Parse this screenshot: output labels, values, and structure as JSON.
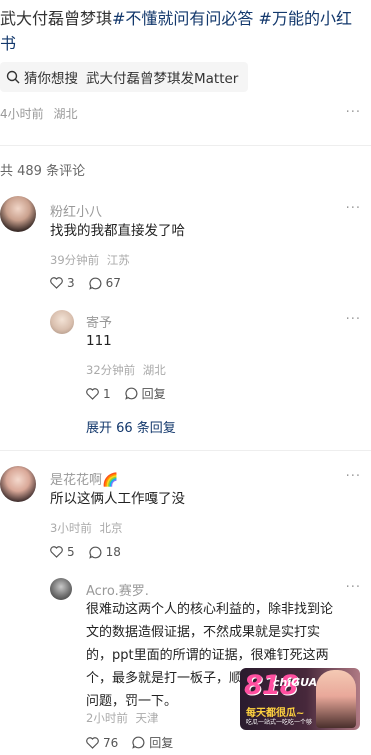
{
  "post": {
    "text_prefix": "武大付磊曾梦琪",
    "tag1": "#不懂就问有问必答",
    "tag2": "#万能的小红",
    "line2": "书",
    "search_chip": {
      "label": "猜你想搜",
      "query": "武大付磊曾梦琪发Matter"
    },
    "time": "4小时前",
    "location": "湖北",
    "more": "···"
  },
  "comments_count": "共 489 条评论",
  "comments": [
    {
      "user": "粉红小八",
      "text": "找我的我都直接发了哈",
      "time": "39分钟前",
      "location": "江苏",
      "likes": "3",
      "replies_count": "67",
      "more": "···",
      "replies": [
        {
          "user": "寄予",
          "text": "111",
          "time": "32分钟前",
          "location": "湖北",
          "likes": "1",
          "reply_label": "回复",
          "more": "···"
        }
      ],
      "expand": "展开 66 条回复"
    },
    {
      "user": "是花花啊🌈",
      "text": "所以这俩人工作嘎了没",
      "time": "3小时前",
      "location": "北京",
      "likes": "5",
      "replies_count": "18",
      "more": "···",
      "replies": [
        {
          "user": "Acro.赛罗.",
          "text_lines": [
            "很难动这两个人的核心利益的，除非找到论",
            "文的数据造假证据，不然成果就是实打实",
            "的，ppt里面的所谓的证据，很难钉死这两",
            "个，最多就是打一板子，顺带发生活混乱的",
            "问题，罚一下。"
          ],
          "time": "2小时前",
          "location": "天津",
          "likes": "76",
          "reply_label": "回复",
          "more": "···"
        }
      ]
    }
  ],
  "watermark": {
    "number": "818",
    "brand": "chiGUA",
    "caption1": "每天都很瓜~",
    "caption2": "吃瓜一站式一吃吃一个够"
  },
  "colors": {
    "tag": "#13386c",
    "meta": "#999999",
    "divider": "#eeeeee"
  }
}
